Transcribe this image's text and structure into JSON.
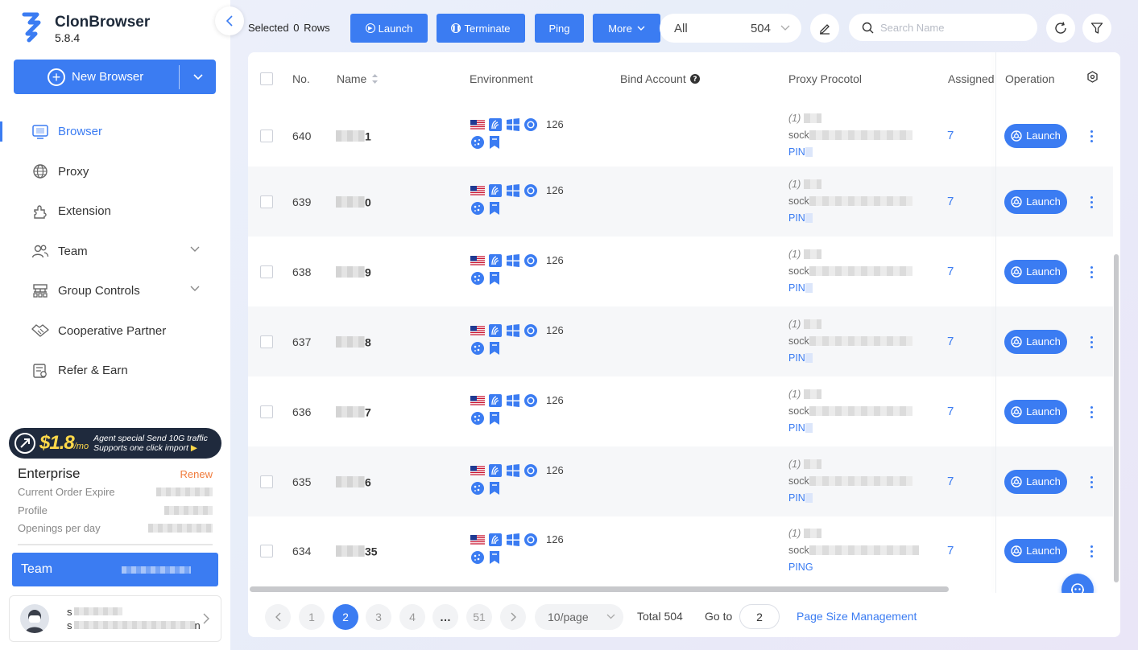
{
  "app": {
    "name": "ClonBrowser",
    "version": "5.8.4"
  },
  "sidebar": {
    "new_browser_label": "New Browser",
    "items": [
      {
        "label": "Browser",
        "icon": "browser-icon",
        "active": true
      },
      {
        "label": "Proxy",
        "icon": "globe-icon"
      },
      {
        "label": "Extension",
        "icon": "puzzle-icon"
      },
      {
        "label": "Team",
        "icon": "team-icon",
        "expandable": true
      },
      {
        "label": "Group Controls",
        "icon": "group-controls-icon",
        "expandable": true
      },
      {
        "label": "Cooperative Partner",
        "icon": "handshake-icon"
      },
      {
        "label": "Refer & Earn",
        "icon": "refer-icon"
      }
    ],
    "promo": {
      "price": "$1.8",
      "unit": "/mo",
      "line1": "Agent special Send 10G traffic",
      "line2": "Supports one click import"
    },
    "plan": {
      "title": "Enterprise",
      "renew_label": "Renew",
      "rows": [
        {
          "label": "Current Order Expire"
        },
        {
          "label": "Profile"
        },
        {
          "label": "Openings per day"
        }
      ]
    },
    "team_label": "Team",
    "user": {
      "line1": "s",
      "line2": "s",
      "line2_end": "n"
    }
  },
  "toolbar": {
    "selected_label": "Selected",
    "selected_count": "0",
    "rows_label": "Rows",
    "launch_label": "Launch",
    "terminate_label": "Terminate",
    "ping_label": "Ping",
    "more_label": "More",
    "filter_value": "All",
    "filter_count": "504",
    "search_placeholder": "Search Name"
  },
  "table": {
    "headers": {
      "no": "No.",
      "name": "Name",
      "environment": "Environment",
      "bind_account": "Bind Account",
      "proxy_protocol": "Proxy Procotol",
      "assigned": "Assigned",
      "operation": "Operation"
    },
    "launch_label": "Launch",
    "rows": [
      {
        "no": "640",
        "name_tail": "1",
        "version": "126",
        "proxy_index": "(1)",
        "proxy_prefix": "sock",
        "proxy_status": "PIN",
        "assigned": "7"
      },
      {
        "no": "639",
        "name_tail": "0",
        "version": "126",
        "proxy_index": "(1)",
        "proxy_prefix": "sock",
        "proxy_status": "PIN",
        "assigned": "7"
      },
      {
        "no": "638",
        "name_tail": "9",
        "version": "126",
        "proxy_index": "(1)",
        "proxy_prefix": "sock",
        "proxy_status": "PIN",
        "assigned": "7"
      },
      {
        "no": "637",
        "name_tail": "8",
        "version": "126",
        "proxy_index": "(1)",
        "proxy_prefix": "sock",
        "proxy_status": "PIN",
        "assigned": "7"
      },
      {
        "no": "636",
        "name_tail": "7",
        "version": "126",
        "proxy_index": "(1)",
        "proxy_prefix": "sock",
        "proxy_status": "PIN",
        "assigned": "7"
      },
      {
        "no": "635",
        "name_tail": "6",
        "version": "126",
        "proxy_index": "(1)",
        "proxy_prefix": "sock",
        "proxy_status": "PIN",
        "assigned": "7"
      },
      {
        "no": "634",
        "name_tail": "35",
        "version": "126",
        "proxy_index": "(1)",
        "proxy_prefix": "sock",
        "proxy_status": "PING",
        "assigned": "7"
      }
    ]
  },
  "pagination": {
    "pages": [
      "1",
      "2",
      "3",
      "4",
      "…",
      "51"
    ],
    "current": "2",
    "page_size": "10/page",
    "total_label": "Total 504",
    "goto_label": "Go to",
    "goto_value": "2",
    "page_size_mgmt": "Page Size Management"
  },
  "colors": {
    "accent": "#3b7cf2",
    "renew": "#f07a3a",
    "promo_bg": "#1f2a3d",
    "promo_highlight": "#ffd84a"
  }
}
